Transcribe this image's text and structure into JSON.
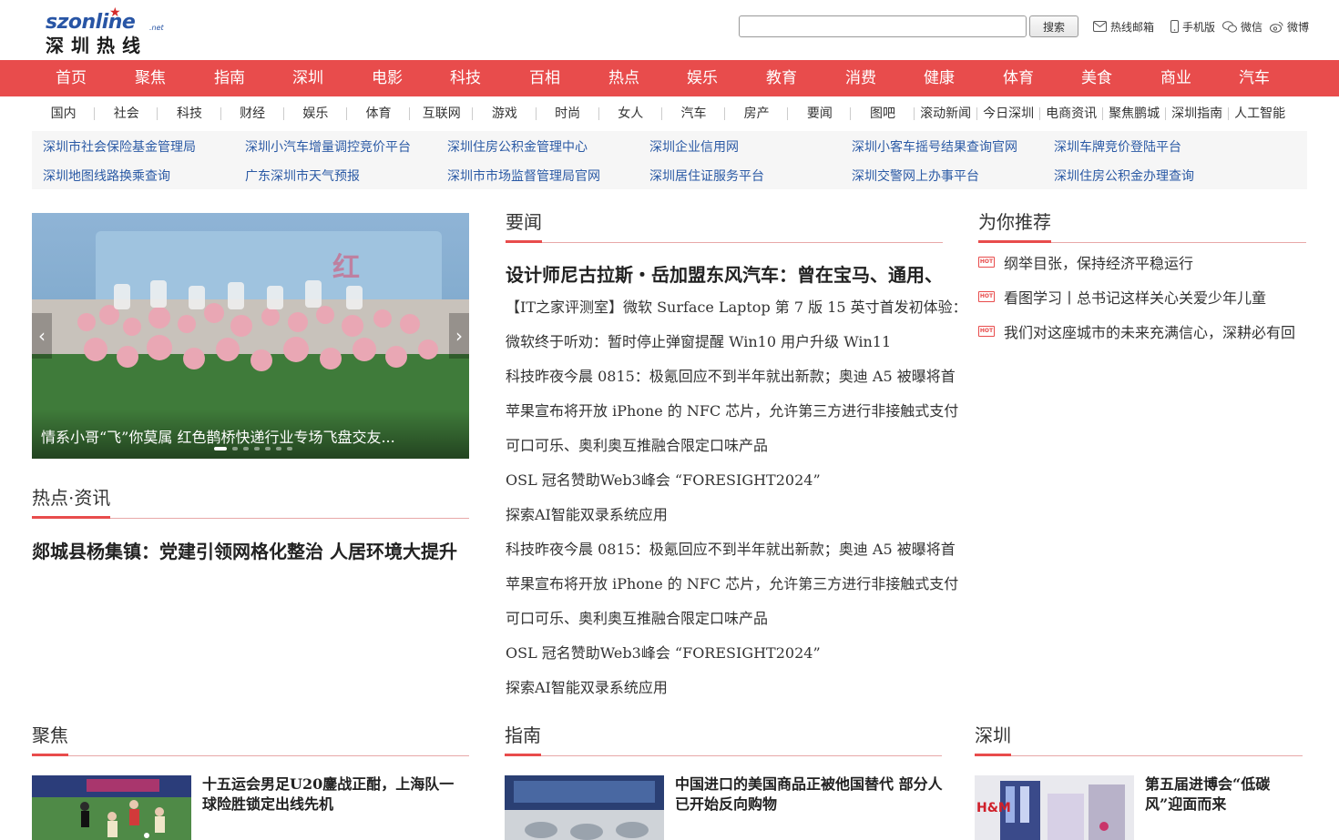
{
  "logo": {
    "en": "szonline",
    "net": ".net",
    "cn": "深圳热线"
  },
  "search": {
    "value": "",
    "button": "搜索"
  },
  "toplinks": [
    {
      "label": "热线邮箱",
      "icon": "mail-icon"
    },
    {
      "label": "手机版",
      "icon": "phone-icon"
    },
    {
      "label": "微信",
      "icon": "wechat-icon"
    },
    {
      "label": "微博",
      "icon": "weibo-icon"
    }
  ],
  "mainnav": [
    "首页",
    "聚焦",
    "指南",
    "深圳",
    "电影",
    "科技",
    "百相",
    "热点",
    "娱乐",
    "教育",
    "消费",
    "健康",
    "体育",
    "美食",
    "商业",
    "汽车"
  ],
  "subnav": [
    "国内",
    "社会",
    "科技",
    "财经",
    "娱乐",
    "体育",
    "互联网",
    "游戏",
    "时尚",
    "女人",
    "汽车",
    "房产",
    "要闻",
    "图吧",
    "滚动新闻",
    "今日深圳",
    "电商资讯",
    "聚焦鹏城",
    "深圳指南",
    "人工智能"
  ],
  "quicklinks": [
    [
      "深圳市社会保险基金管理局",
      "深圳小汽车增量调控竞价平台",
      "深圳住房公积金管理中心",
      "深圳企业信用网",
      "深圳小客车摇号结果查询官网",
      "深圳车牌竞价登陆平台"
    ],
    [
      "深圳地图线路换乘查询",
      "广东深圳市天气预报",
      "深圳市市场监督管理局官网",
      "深圳居住证服务平台",
      "深圳交警网上办事平台",
      "深圳住房公积金办理查询"
    ]
  ],
  "slider": {
    "caption": "情系小哥“飞”你莫属 红色鹊桥快递行业专场飞盘交友...",
    "prev": "‹",
    "next": "›",
    "dot_count": 7,
    "active_dot": 0
  },
  "hot": {
    "title": "热点·资讯",
    "headline": "郯城县杨集镇：党建引领网格化整治 人居环境大提升"
  },
  "news": {
    "title": "要闻",
    "headline": "设计师尼古拉斯・岳加盟东风汽车：曾在宝马、通用、",
    "items": [
      "【IT之家评测室】微软 Surface Laptop 第 7 版 15 英寸首发初体验：",
      "微软终于听劝：暂时停止弹窗提醒 Win10 用户升级 Win11",
      "科技昨夜今晨 0815：极氪回应不到半年就出新款；奥迪 A5 被曝将首",
      "苹果宣布将开放 iPhone 的 NFC 芯片，允许第三方进行非接触式支付",
      "可口可乐、奥利奥互推融合限定口味产品",
      "OSL 冠名赞助Web3峰会 “FORESIGHT2024”",
      "探索AI智能双录系统应用",
      "科技昨夜今晨 0815：极氪回应不到半年就出新款；奥迪 A5 被曝将首",
      "苹果宣布将开放 iPhone 的 NFC 芯片，允许第三方进行非接触式支付",
      "可口可乐、奥利奥互推融合限定口味产品",
      "OSL 冠名赞助Web3峰会 “FORESIGHT2024”",
      "探索AI智能双录系统应用"
    ]
  },
  "recommend": {
    "title": "为你推荐",
    "badge": "HOT",
    "items": [
      "纲举目张，保持经济平稳运行",
      "看图学习丨总书记这样关心关爱少年儿童",
      "我们对这座城市的未来充满信心，深耕必有回"
    ]
  },
  "bottom": [
    {
      "title": "聚焦",
      "card": "十五运会男足U20鏖战正酣，上海队一球险胜锁定出线先机"
    },
    {
      "title": "指南",
      "card": "中国进口的美国商品正被他国替代 部分人已开始反向购物"
    },
    {
      "title": "深圳",
      "card": "第五届进博会“低碳风”迎面而来"
    }
  ],
  "colors": {
    "accent": "#e84c4c",
    "link": "#2b5aa5",
    "brand": "#2855a5"
  }
}
